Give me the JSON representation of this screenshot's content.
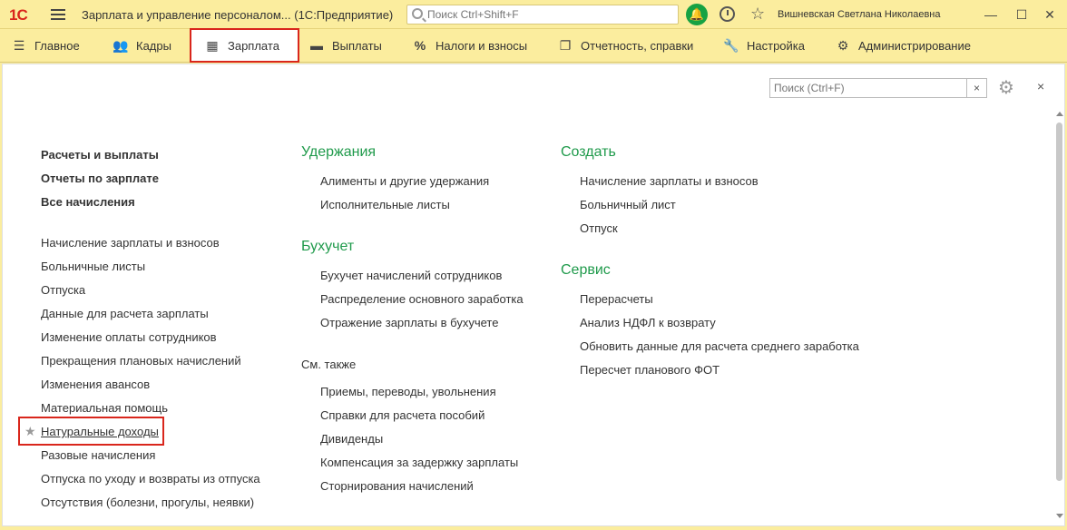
{
  "titlebar": {
    "logo": "1С",
    "title": "Зарплата и управление персоналом...  (1С:Предприятие)",
    "search_placeholder": "Поиск Ctrl+Shift+F",
    "user": "Вишневская Светлана Николаевна",
    "minimize": "—",
    "maximize": "☐",
    "close": "✕"
  },
  "sections": [
    {
      "label": "Главное",
      "icon": "hamburger-icon"
    },
    {
      "label": "Кадры",
      "icon": "people-icon"
    },
    {
      "label": "Зарплата",
      "icon": "calculator-icon"
    },
    {
      "label": "Выплаты",
      "icon": "wallet-icon"
    },
    {
      "label": "Налоги и взносы",
      "icon": "percent-icon"
    },
    {
      "label": "Отчетность, справки",
      "icon": "documents-icon"
    },
    {
      "label": "Настройка",
      "icon": "wrench-icon"
    },
    {
      "label": "Администрирование",
      "icon": "gear-icon"
    }
  ],
  "form": {
    "search_placeholder": "Поиск (Ctrl+F)",
    "clear": "×",
    "close": "×"
  },
  "left": {
    "bold": [
      "Расчеты и выплаты",
      "Отчеты по зарплате",
      "Все начисления"
    ],
    "links": [
      "Начисление зарплаты и взносов",
      "Больничные листы",
      "Отпуска",
      "Данные для расчета зарплаты",
      "Изменение оплаты сотрудников",
      "Прекращения плановых начислений",
      "Изменения авансов",
      "Материальная помощь",
      "Натуральные доходы",
      "Разовые начисления",
      "Отпуска по уходу и возвраты из отпуска",
      "Отсутствия (болезни, прогулы, неявки)"
    ]
  },
  "middle": {
    "uderzhaniya": {
      "title": "Удержания",
      "links": [
        "Алименты и другие удержания",
        "Исполнительные листы"
      ]
    },
    "buhuchet": {
      "title": "Бухучет",
      "links": [
        "Бухучет начислений сотрудников",
        "Распределение основного заработка",
        "Отражение зарплаты в бухучете"
      ]
    },
    "see_also": {
      "title": "См. также",
      "links": [
        "Приемы, переводы, увольнения",
        "Справки для расчета пособий",
        "Дивиденды",
        "Компенсация за задержку зарплаты",
        "Сторнирования начислений"
      ]
    }
  },
  "right": {
    "create": {
      "title": "Создать",
      "links": [
        "Начисление зарплаты и взносов",
        "Больничный лист",
        "Отпуск"
      ]
    },
    "service": {
      "title": "Сервис",
      "links": [
        "Перерасчеты",
        "Анализ НДФЛ к возврату",
        "Обновить данные для расчета среднего заработка",
        "Пересчет планового ФОТ"
      ]
    }
  }
}
